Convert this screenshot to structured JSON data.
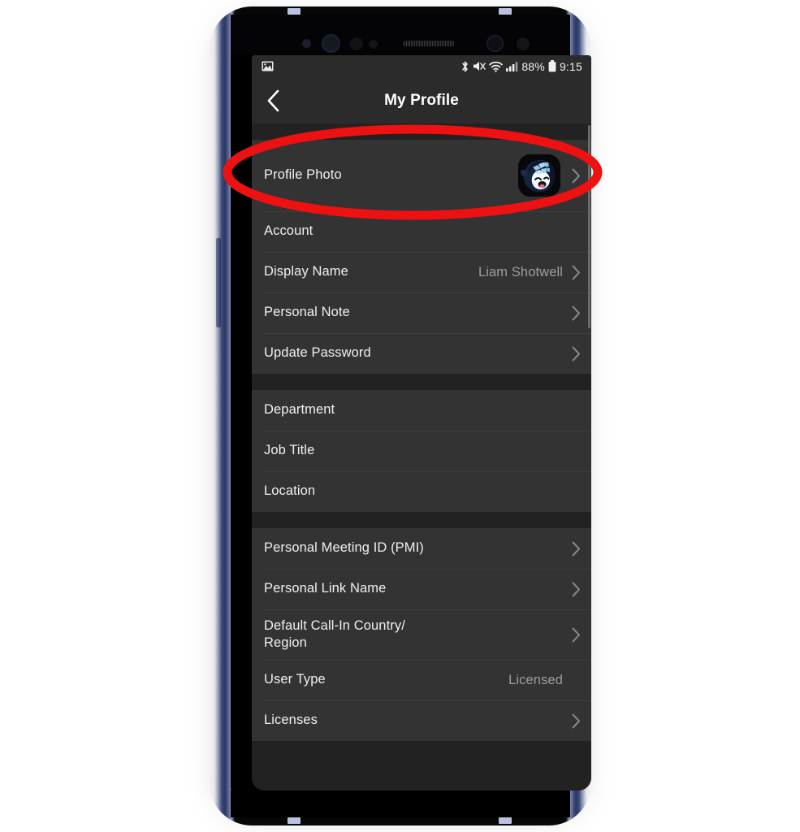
{
  "statusbar": {
    "notification_icon": "image-screenshot-icon",
    "icons": [
      "bluetooth-icon",
      "volume-mute-icon",
      "wifi-icon",
      "cellular-signal-icon"
    ],
    "battery_percent": "88%",
    "battery_icon": "battery-full-icon",
    "time": "9:15"
  },
  "navbar": {
    "back_icon": "chevron-left-icon",
    "title": "My Profile"
  },
  "sections": [
    {
      "id": "photo-account",
      "rows": [
        {
          "label": "Profile Photo",
          "value": "",
          "chevron": true,
          "avatar": true,
          "tall": true
        },
        {
          "label": "Account",
          "value": "",
          "chevron": false,
          "avatar": false
        },
        {
          "label": "Display Name",
          "value": "Liam Shotwell",
          "chevron": true,
          "avatar": false
        },
        {
          "label": "Personal Note",
          "value": "",
          "chevron": true,
          "avatar": false
        },
        {
          "label": "Update Password",
          "value": "",
          "chevron": true,
          "avatar": false
        }
      ]
    },
    {
      "id": "org-info",
      "rows": [
        {
          "label": "Department",
          "value": "",
          "chevron": false,
          "avatar": false
        },
        {
          "label": "Job Title",
          "value": "",
          "chevron": false,
          "avatar": false
        },
        {
          "label": "Location",
          "value": "",
          "chevron": false,
          "avatar": false
        }
      ]
    },
    {
      "id": "meeting-info",
      "rows": [
        {
          "label": "Personal Meeting ID (PMI)",
          "value": "",
          "chevron": true,
          "avatar": false
        },
        {
          "label": "Personal Link Name",
          "value": "",
          "chevron": true,
          "avatar": false
        },
        {
          "label": "Default Call-In Country/\nRegion",
          "value": "",
          "chevron": true,
          "avatar": false,
          "twoLine": true
        },
        {
          "label": "User Type",
          "value": "Licensed",
          "chevron": false,
          "avatar": false
        },
        {
          "label": "Licenses",
          "value": "",
          "chevron": true,
          "avatar": false
        }
      ]
    }
  ],
  "annotation": {
    "shape": "ellipse",
    "color": "#ee1111",
    "target": "Profile Photo"
  },
  "colors": {
    "screen_bg": "#222222",
    "row_bg": "#333333",
    "chrome_bg": "#2b2b2b",
    "text_primary": "#f0f0f0",
    "text_secondary": "#9d9d9d",
    "annotation_red": "#ee1111"
  }
}
